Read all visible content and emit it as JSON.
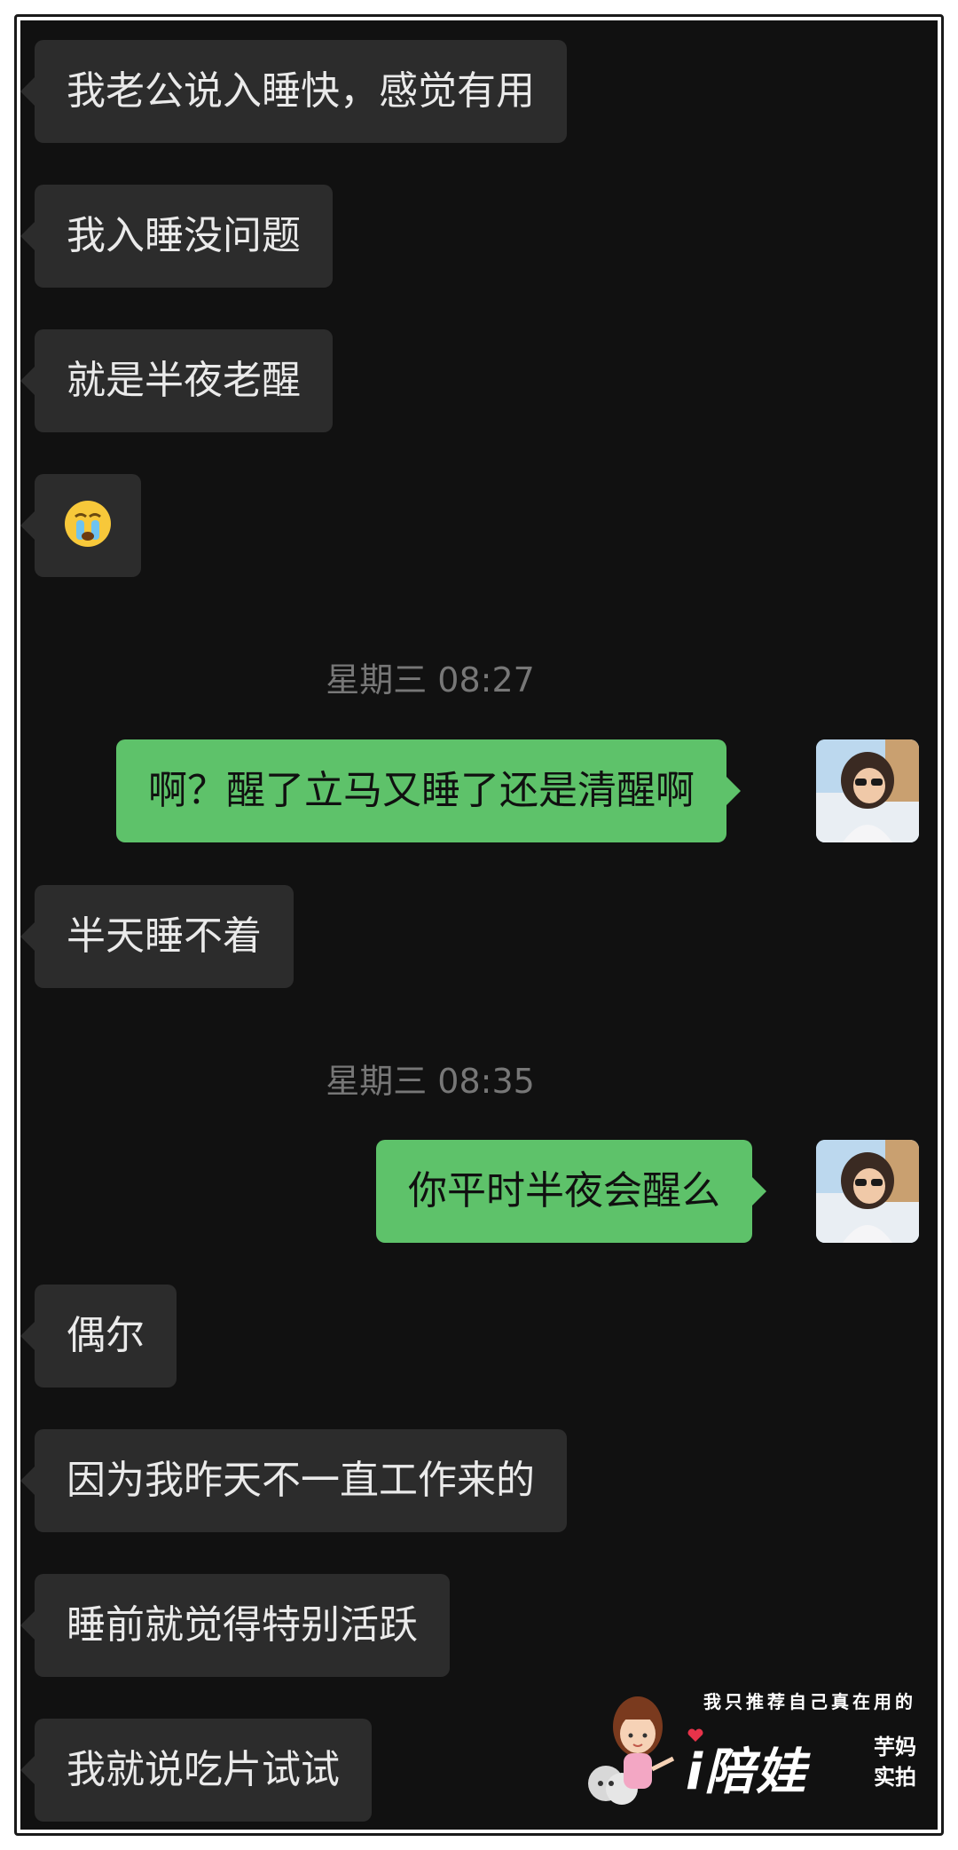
{
  "conversation": {
    "messages": [
      {
        "side": "in",
        "text": "我老公说入睡快，感觉有用"
      },
      {
        "side": "in",
        "text": "我入睡没问题"
      },
      {
        "side": "in",
        "text": "就是半夜老醒"
      },
      {
        "side": "in",
        "emoji": "crying-face"
      },
      {
        "side": "time",
        "text": "星期三 08:27"
      },
      {
        "side": "out",
        "text": "啊？醒了立马又睡了还是清醒啊"
      },
      {
        "side": "in",
        "text": "半天睡不着"
      },
      {
        "side": "time",
        "text": "星期三 08:35"
      },
      {
        "side": "out",
        "text": "你平时半夜会醒么"
      },
      {
        "side": "in",
        "text": "偶尔"
      },
      {
        "side": "in",
        "text": "因为我昨天不一直工作来的"
      },
      {
        "side": "in",
        "text": "睡前就觉得特别活跃"
      },
      {
        "side": "in",
        "text": "我就说吃片试试"
      }
    ]
  },
  "watermark": {
    "tagline": "我只推荐自己真在用的",
    "brand": "i陪娃",
    "side_top": "芋妈",
    "side_bottom": "实拍"
  },
  "colors": {
    "background": "#111111",
    "incoming_bubble": "#2c2c2c",
    "outgoing_bubble": "#5ec26a",
    "timestamp_text": "#777777"
  }
}
